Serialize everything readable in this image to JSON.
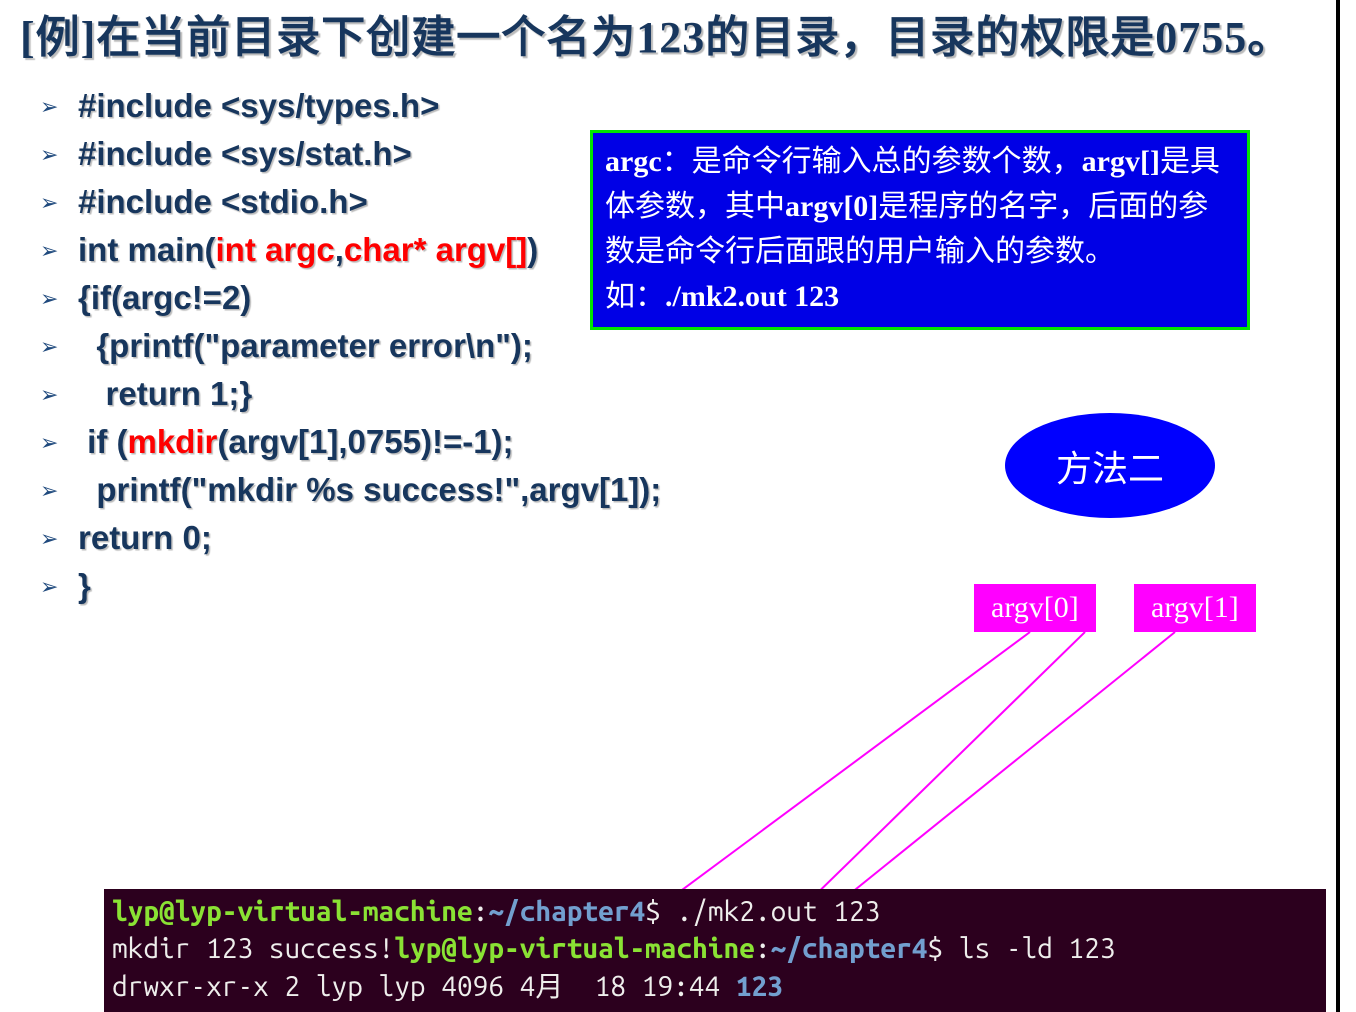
{
  "title": "[例]在当前目录下创建一个名为123的目录，目录的权限是0755。",
  "code": {
    "l1": "#include <sys/types.h>",
    "l2": "#include <sys/stat.h>",
    "l3": "#include <stdio.h>",
    "l4a": "int main(",
    "l4b": "int argc",
    "l4c": ",",
    "l4d": "char* argv[]",
    "l4e": ")",
    "l5": "{if(argc!=2)",
    "l6": "  {printf(\"parameter error\\n\");",
    "l7": "   return 1;}",
    "l8a": " if (",
    "l8b": "mkdir",
    "l8c": "(argv[1],0755)!=-1);",
    "l9": "  printf(\"mkdir %s success!\",argv[1]);",
    "l10": "return 0;",
    "l11": "}"
  },
  "info": {
    "l1_a": "argc",
    "l1_b": "：是命令行输入总的参数个数，",
    "l2_a": "argv[]",
    "l2_b": "是具体参数，其中",
    "l2_c": "argv[0]",
    "l2_d": "是程序的名字，后面的参数是命令行后面跟的用户输入的参数。",
    "l3_a": "如：",
    "l3_b": "./mk2.out    123"
  },
  "ellipse_label": "方法二",
  "argv0_label": "argv[0]",
  "argv1_label": "argv[1]",
  "terminal": {
    "prompt_user": "lyp@lyp-virtual-machine",
    "colon": ":",
    "prompt_path": "~/chapter4",
    "dollar": "$",
    "cmd1": " ./mk2.out 123",
    "out1": "mkdir 123 success!",
    "cmd2": " ls -ld 123",
    "out2_a": "drwxr-xr-x 2 lyp lyp 4096 4月  18 19:44 ",
    "out2_b": "123"
  }
}
